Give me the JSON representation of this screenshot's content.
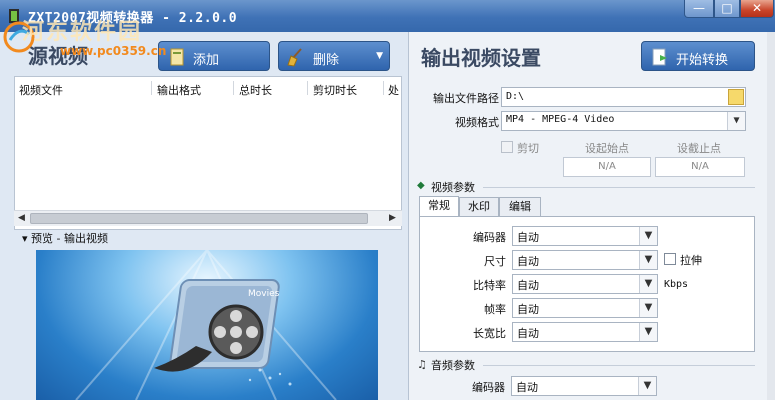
{
  "window": {
    "title": "ZXT2007视频转换器 - 2.2.0.0",
    "min_glyph": "—",
    "max_glyph": "□",
    "close_glyph": "✕"
  },
  "watermark": {
    "text": "河东软件园",
    "url": "www.pc0359.cn"
  },
  "source": {
    "title": "源视频",
    "add_label": "添加",
    "delete_label": "删除",
    "columns": [
      "视频文件",
      "输出格式",
      "总时长",
      "剪切时长",
      "处"
    ]
  },
  "preview": {
    "label": "▾ 预览 - 输出视频",
    "badge": "Movies"
  },
  "output": {
    "title": "输出视频设置",
    "start_label": "开始转换",
    "path_label": "输出文件路径",
    "path_value": "D:\\",
    "format_label": "视频格式",
    "format_value": "MP4 - MPEG-4 Video",
    "cut_label": "剪切",
    "start_point_label": "设起始点",
    "end_point_label": "设截止点",
    "start_point_value": "N/A",
    "end_point_value": "N/A"
  },
  "video_params": {
    "title": "视频参数",
    "tabs": [
      "常规",
      "水印",
      "编辑"
    ],
    "rows": [
      {
        "label": "编码器",
        "value": "自动"
      },
      {
        "label": "尺寸",
        "value": "自动"
      },
      {
        "label": "比特率",
        "value": "自动"
      },
      {
        "label": "帧率",
        "value": "自动"
      },
      {
        "label": "长宽比",
        "value": "自动"
      }
    ],
    "stretch_label": "拉伸",
    "bitrate_unit": "Kbps"
  },
  "audio_params": {
    "title": "音频参数",
    "rows": [
      {
        "label": "编码器",
        "value": "自动"
      }
    ]
  },
  "colors": {
    "titlebar": "#3f72b6",
    "button_blue": "#2f64ad",
    "panel_bg": "#dfe8f3"
  }
}
